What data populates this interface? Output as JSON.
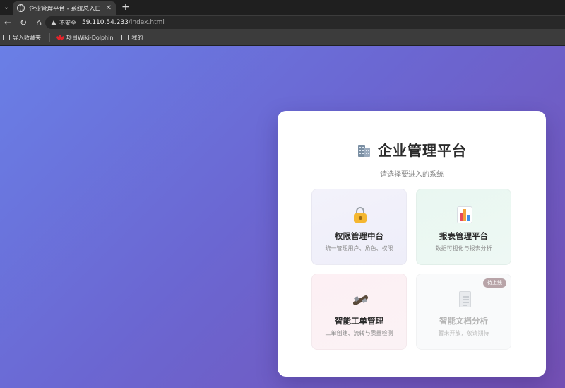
{
  "browser": {
    "tab_title": "企业管理平台 - 系统总入口",
    "tab_close": "✕",
    "new_tab": "+",
    "insecure_label": "不安全",
    "url_host": "59.110.54.233",
    "url_path": "/index.html",
    "bookmarks": [
      {
        "label": "导入收藏夹",
        "icon": "folder-icon"
      },
      {
        "label": "项目Wiki-Dolphin",
        "icon": "huawei-icon"
      },
      {
        "label": "我的",
        "icon": "folder-icon"
      }
    ]
  },
  "page": {
    "title": "企业管理平台",
    "title_icon": "building-icon",
    "subtitle": "请选择要进入的系统",
    "cards": [
      {
        "title": "权限管理中台",
        "desc": "统一管理用户、角色、权限",
        "icon": "lock-icon",
        "status": "active"
      },
      {
        "title": "报表管理平台",
        "desc": "数据可视化与报表分析",
        "icon": "bar-chart-icon",
        "status": "active"
      },
      {
        "title": "智能工单管理",
        "desc": "工单创建、流转与质量检测",
        "icon": "tools-icon",
        "status": "active"
      },
      {
        "title": "智能文档分析",
        "desc": "暂未开放，敬请期待",
        "icon": "document-icon",
        "status": "disabled",
        "badge": "待上线"
      }
    ]
  },
  "colors": {
    "gradient_start": "#6a7fe6",
    "gradient_end": "#7450b4",
    "badge": "#b8a4a8"
  }
}
